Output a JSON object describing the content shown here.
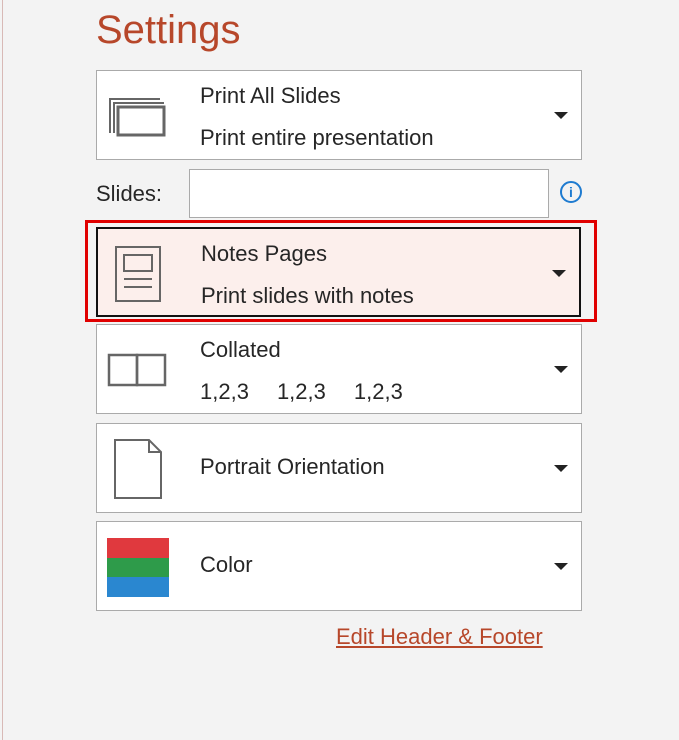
{
  "title": "Settings",
  "print_range": {
    "label": "Print All Slides",
    "description": "Print entire presentation"
  },
  "slides": {
    "label": "Slides:",
    "value": "",
    "info_icon": "info-icon"
  },
  "layout": {
    "label": "Notes Pages",
    "description": "Print slides with notes"
  },
  "collation": {
    "label": "Collated",
    "sequence": [
      "1,2,3",
      "1,2,3",
      "1,2,3"
    ]
  },
  "orientation": {
    "label": "Portrait Orientation"
  },
  "color": {
    "label": "Color",
    "swatch": [
      "#e0393e",
      "#2e9b4a",
      "#2a87d0"
    ]
  },
  "edit_link": "Edit Header & Footer",
  "colors": {
    "accent": "#b7472a",
    "highlight": "#e00000"
  }
}
